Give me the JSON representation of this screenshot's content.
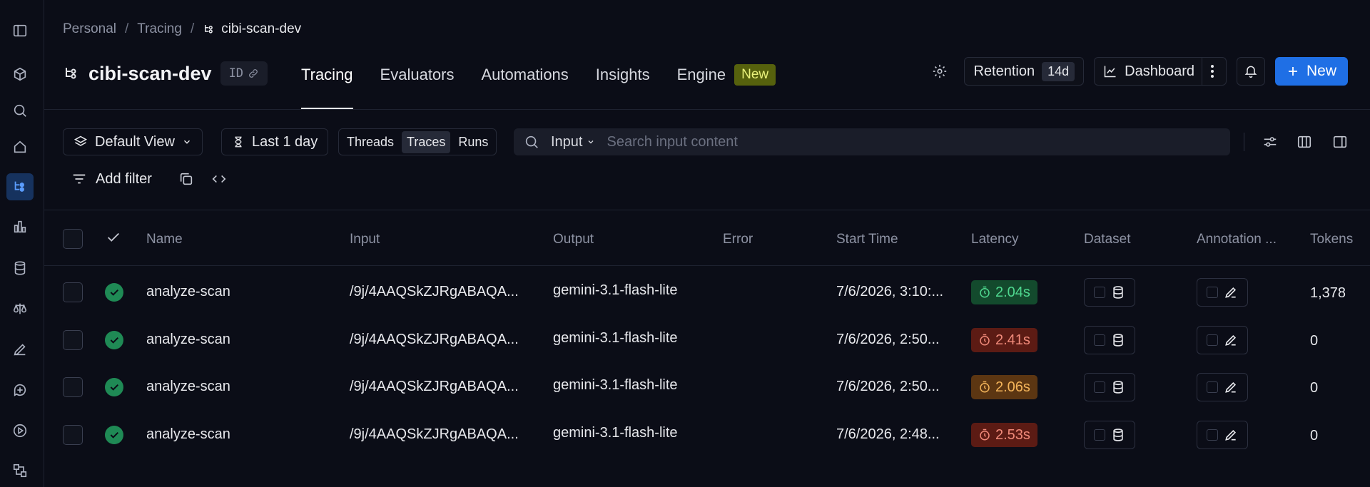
{
  "breadcrumb": {
    "items": [
      "Personal",
      "Tracing"
    ],
    "current": "cibi-scan-dev"
  },
  "project": {
    "title": "cibi-scan-dev",
    "id_label": "ID"
  },
  "tabs": [
    {
      "label": "Tracing",
      "active": true
    },
    {
      "label": "Evaluators"
    },
    {
      "label": "Automations"
    },
    {
      "label": "Insights"
    },
    {
      "label": "Engine",
      "badge": "New"
    }
  ],
  "header_actions": {
    "retention_label": "Retention",
    "retention_value": "14d",
    "dashboard_label": "Dashboard",
    "new_label": "New"
  },
  "toolbar": {
    "view_label": "Default View",
    "time_label": "Last 1 day",
    "segments": [
      "Threads",
      "Traces",
      "Runs"
    ],
    "active_segment": "Traces",
    "search_field": "Input",
    "search_placeholder": "Search input content",
    "add_filter_label": "Add filter"
  },
  "columns": [
    "Name",
    "Input",
    "Output",
    "Error",
    "Start Time",
    "Latency",
    "Dataset",
    "Annotation ...",
    "Tokens"
  ],
  "rows": [
    {
      "name": "analyze-scan",
      "input": "/9j/4AAQSkZJRgABAQA...",
      "output": "gemini-3.1-flash-lite",
      "error": "",
      "start_time": "7/6/2026, 3:10:...",
      "latency": "2.04s",
      "latency_level": "green",
      "tokens": "1,378"
    },
    {
      "name": "analyze-scan",
      "input": "/9j/4AAQSkZJRgABAQA...",
      "output": "gemini-3.1-flash-lite",
      "error": "",
      "start_time": "7/6/2026, 2:50...",
      "latency": "2.41s",
      "latency_level": "red",
      "tokens": "0"
    },
    {
      "name": "analyze-scan",
      "input": "/9j/4AAQSkZJRgABAQA...",
      "output": "gemini-3.1-flash-lite",
      "error": "",
      "start_time": "7/6/2026, 2:50...",
      "latency": "2.06s",
      "latency_level": "orange",
      "tokens": "0"
    },
    {
      "name": "analyze-scan",
      "input": "/9j/4AAQSkZJRgABAQA...",
      "output": "gemini-3.1-flash-lite",
      "error": "",
      "start_time": "7/6/2026, 2:48...",
      "latency": "2.53s",
      "latency_level": "red",
      "tokens": "0"
    }
  ],
  "colors": {
    "accent": "#1f6fe5",
    "background": "#0b0d17",
    "success": "#1f8a55"
  },
  "sidebar_icons": [
    "panel-toggle-icon",
    "cube-icon",
    "search-icon",
    "home-icon",
    "tracing-icon",
    "chart-icon",
    "database-icon",
    "scale-icon",
    "pen-icon",
    "chat-plus-icon",
    "play-icon",
    "workflow-icon"
  ]
}
